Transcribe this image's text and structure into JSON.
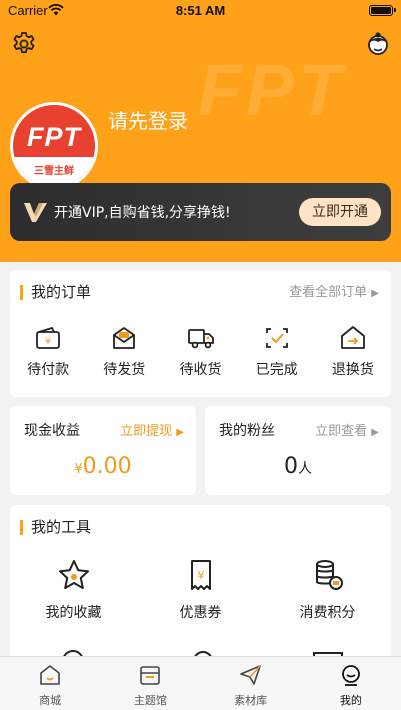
{
  "status_bar": {
    "carrier": "Carrier",
    "time": "8:51 AM"
  },
  "header": {
    "watermark": "FPT",
    "login_text": "请先登录",
    "logo_text": "FPT",
    "logo_subtext": "三雪主鲜"
  },
  "vip_banner": {
    "text": "开通VIP,自购省钱,分享挣钱!",
    "button": "立即开通"
  },
  "orders": {
    "title": "我的订单",
    "view_all": "查看全部订单",
    "items": [
      {
        "label": "待付款",
        "icon": "wallet-icon"
      },
      {
        "label": "待发货",
        "icon": "envelope-box-icon"
      },
      {
        "label": "待收货",
        "icon": "truck-icon"
      },
      {
        "label": "已完成",
        "icon": "check-frame-icon"
      },
      {
        "label": "退换货",
        "icon": "return-house-icon"
      }
    ]
  },
  "earnings": {
    "title": "现金收益",
    "link": "立即提现",
    "currency": "¥",
    "amount": "0.00"
  },
  "fans": {
    "title": "我的粉丝",
    "link": "立即查看",
    "count": "0",
    "unit": "人"
  },
  "tools": {
    "title": "我的工具",
    "items": [
      {
        "label": "我的收藏",
        "icon": "star-icon"
      },
      {
        "label": "优惠券",
        "icon": "coupon-icon"
      },
      {
        "label": "消费积分",
        "icon": "coins-icon"
      }
    ]
  },
  "tab_bar": {
    "items": [
      {
        "label": "商城",
        "icon": "home-icon"
      },
      {
        "label": "主题馆",
        "icon": "store-icon"
      },
      {
        "label": "素材库",
        "icon": "paper-plane-icon"
      },
      {
        "label": "我的",
        "icon": "profile-icon"
      }
    ],
    "active_index": 3
  },
  "colors": {
    "brand_orange": "#ffa21a",
    "accent_orange": "#f39a1c",
    "logo_red": "#e8412f"
  }
}
